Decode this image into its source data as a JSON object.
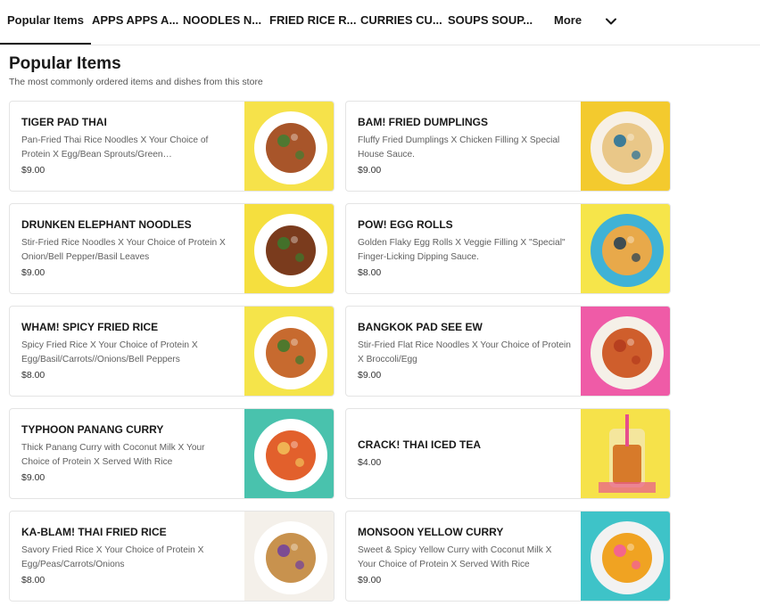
{
  "tabs": [
    {
      "label": "Popular Items"
    },
    {
      "label": "APPS APPS A..."
    },
    {
      "label": "NOODLES N..."
    },
    {
      "label": "FRIED RICE R..."
    },
    {
      "label": "CURRIES CU..."
    },
    {
      "label": "SOUPS SOUP..."
    },
    {
      "label": "More"
    }
  ],
  "section": {
    "title": "Popular Items",
    "subtitle": "The most commonly ordered items and dishes from this store"
  },
  "items": [
    {
      "name": "TIGER PAD THAI",
      "desc": "Pan-Fried Thai Rice Noodles X Your Choice of Protein X Egg/Bean Sprouts/Green…",
      "price": "$9.00"
    },
    {
      "name": "BAM! FRIED DUMPLINGS",
      "desc": "Fluffy Fried Dumplings X Chicken Filling X Special House Sauce.",
      "price": "$9.00"
    },
    {
      "name": "DRUNKEN ELEPHANT NOODLES",
      "desc": "Stir-Fried Rice Noodles X Your Choice of Protein X Onion/Bell Pepper/Basil Leaves",
      "price": "$9.00"
    },
    {
      "name": "POW! EGG ROLLS",
      "desc": "Golden Flaky Egg Rolls X Veggie Filling X \"Special\" Finger-Licking Dipping Sauce.",
      "price": "$8.00"
    },
    {
      "name": "WHAM! SPICY FRIED RICE",
      "desc": "Spicy Fried Rice X Your Choice of Protein X Egg/Basil/Carrots//Onions/Bell Peppers",
      "price": "$8.00"
    },
    {
      "name": "BANGKOK PAD SEE EW",
      "desc": "Stir-Fried Flat Rice Noodles X Your Choice of Protein X Broccoli/Egg",
      "price": "$9.00"
    },
    {
      "name": "TYPHOON PANANG CURRY",
      "desc": "Thick Panang Curry with Coconut Milk X Your Choice of Protein X Served With Rice",
      "price": "$9.00"
    },
    {
      "name": "CRACK! THAI ICED TEA",
      "desc": "",
      "price": "$4.00"
    },
    {
      "name": "KA-BLAM! THAI FRIED RICE",
      "desc": "Savory Fried Rice X Your Choice of Protein X Egg/Peas/Carrots/Onions",
      "price": "$8.00"
    },
    {
      "name": "MONSOON YELLOW CURRY",
      "desc": "Sweet & Spicy Yellow Curry with Coconut Milk X Your Choice of Protein X Served With Rice",
      "price": "$9.00"
    }
  ],
  "photos": [
    {
      "bg": "#f6e24a",
      "plate": "#ffffff",
      "food": "#a8552a",
      "accent": "#3f7f33"
    },
    {
      "bg": "#f3ca2e",
      "plate": "#f7f0e6",
      "food": "#e9c788",
      "accent": "#1f6e9a"
    },
    {
      "bg": "#f5df3e",
      "plate": "#ffffff",
      "food": "#7a3b1d",
      "accent": "#3a7a2d"
    },
    {
      "bg": "#f6e54a",
      "plate": "#3fb2d6",
      "food": "#e8a94a",
      "accent": "#203d55"
    },
    {
      "bg": "#f5e44a",
      "plate": "#ffffff",
      "food": "#c76a2f",
      "accent": "#3a7a2d"
    },
    {
      "bg": "#ef5ba7",
      "plate": "#f5f0e8",
      "food": "#cf5e2c",
      "accent": "#b33a1d"
    },
    {
      "bg": "#49c2ad",
      "plate": "#ffffff",
      "food": "#e2602c",
      "accent": "#f2c25a"
    },
    {
      "bg": "#f6e24a",
      "plate": "#f0f0f0",
      "food": "#d77a2a",
      "accent": "#e64e8c"
    },
    {
      "bg": "#f4f0ea",
      "plate": "#ffffff",
      "food": "#c8924e",
      "accent": "#6e3fa0"
    },
    {
      "bg": "#3ec3c8",
      "plate": "#f2f2f2",
      "food": "#f0a322",
      "accent": "#f45aa0"
    }
  ]
}
